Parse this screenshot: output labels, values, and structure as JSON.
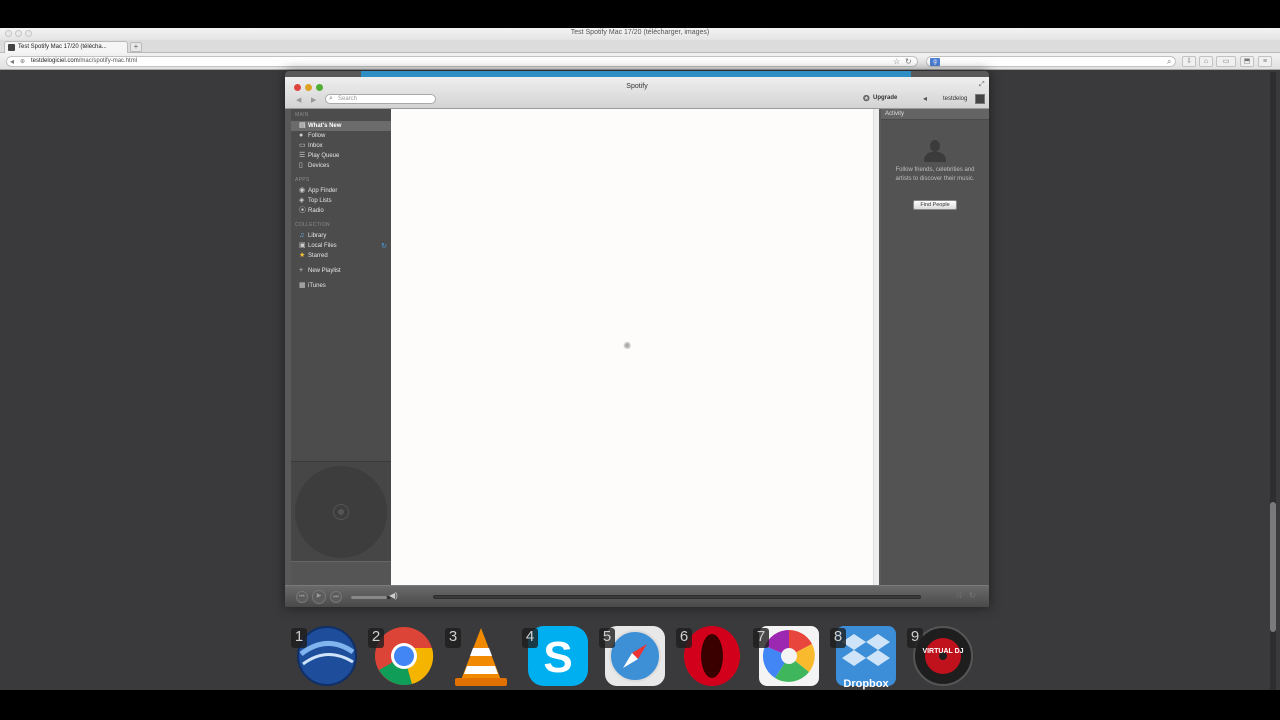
{
  "browser": {
    "window_title": "Test Spotify Mac 17/20 (télécharger, images)",
    "tab_title": "Test Spotify Mac 17/20 (télécha...",
    "new_tab_label": "+",
    "url_host": "testdelogiciel.com",
    "url_path": "/mac/spotify-mac.html"
  },
  "spotify": {
    "window_title": "Spotify",
    "search_placeholder": "Search",
    "upgrade_label": "Upgrade",
    "username": "testdelog",
    "sidebar": {
      "main_header": "MAIN",
      "main_items": [
        {
          "label": "What's New",
          "icon": "whats-new-icon"
        },
        {
          "label": "Follow",
          "icon": "follow-icon"
        },
        {
          "label": "Inbox",
          "icon": "inbox-icon"
        },
        {
          "label": "Play Queue",
          "icon": "play-queue-icon"
        },
        {
          "label": "Devices",
          "icon": "devices-icon"
        }
      ],
      "apps_header": "APPS",
      "apps_items": [
        {
          "label": "App Finder",
          "icon": "app-finder-icon"
        },
        {
          "label": "Top Lists",
          "icon": "top-lists-icon"
        },
        {
          "label": "Radio",
          "icon": "radio-icon"
        }
      ],
      "collection_header": "COLLECTION",
      "collection_items": [
        {
          "label": "Library",
          "icon": "library-icon"
        },
        {
          "label": "Local Files",
          "icon": "local-files-icon"
        },
        {
          "label": "Starred",
          "icon": "star-icon"
        }
      ],
      "new_playlist_label": "New Playlist",
      "itunes_label": "iTunes"
    },
    "activity": {
      "header": "Activity",
      "message": "Follow friends, celebrities and artists to discover their music.",
      "button_label": "Find People"
    }
  },
  "dock": {
    "items": [
      {
        "num": "1",
        "name": "google-earth",
        "label": ""
      },
      {
        "num": "2",
        "name": "chrome",
        "label": ""
      },
      {
        "num": "3",
        "name": "vlc",
        "label": ""
      },
      {
        "num": "4",
        "name": "skype",
        "label": ""
      },
      {
        "num": "5",
        "name": "safari",
        "label": ""
      },
      {
        "num": "6",
        "name": "opera",
        "label": ""
      },
      {
        "num": "7",
        "name": "picasa",
        "label": ""
      },
      {
        "num": "8",
        "name": "dropbox",
        "label": "Dropbox"
      },
      {
        "num": "9",
        "name": "virtual-dj",
        "label": "VIRTUAL DJ"
      }
    ]
  },
  "colors": {
    "spotify_banner": "#2f8fc4",
    "sidebar_bg": "#4c4c4c",
    "main_bg": "#fefcfa",
    "sync_blue": "#4aa3e8"
  }
}
